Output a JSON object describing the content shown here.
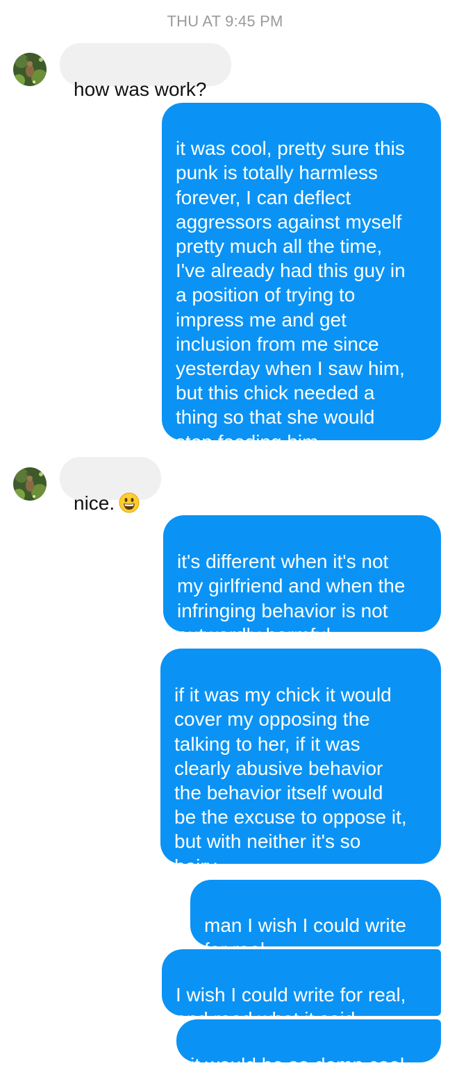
{
  "header": {
    "timestamp": "THU AT 9:45 PM"
  },
  "contact": {
    "avatar_icon": "deer-photo-avatar"
  },
  "colors": {
    "outgoing_bubble": "#0a93f5",
    "incoming_bubble": "#f1f0f0",
    "timestamp_text": "#9a9a9a"
  },
  "messages": [
    {
      "direction": "incoming",
      "text": "how was work?"
    },
    {
      "direction": "outgoing",
      "text": "it was cool, pretty sure this\npunk is totally harmless\nforever, I can deflect\naggressors against myself\npretty much all the time,\nI've already had this guy in\na position of trying to\nimpress me and get\ninclusion from me since\nyesterday when I saw him,\nbut this chick needed a\nthing so that she would\nstop feeding him"
    },
    {
      "direction": "incoming",
      "text": "nice.",
      "emoji": "grinning-face-emoji"
    },
    {
      "direction": "outgoing",
      "text": "it's different when it's not\nmy girlfriend and when the\ninfringing behavior is not\noutwardly harmful"
    },
    {
      "direction": "outgoing",
      "text": "if it was my chick it would\ncover my opposing the\ntalking to her, if it was\nclearly abusive behavior\nthe behavior itself would\nbe the excuse to oppose it,\nbut with neither it's so\nhairy"
    },
    {
      "direction": "outgoing",
      "text": "man I wish I could write\nfor real"
    },
    {
      "direction": "outgoing",
      "text": "I wish I could write for real,\nand read what it said"
    },
    {
      "direction": "outgoing",
      "text": "it would be so damn cool"
    }
  ]
}
